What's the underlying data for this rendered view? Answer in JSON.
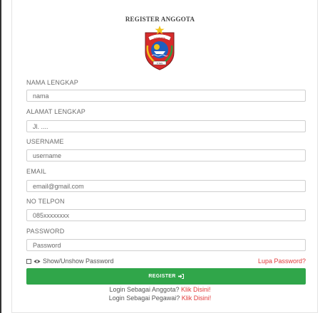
{
  "form": {
    "title": "REGISTER ANGGOTA",
    "logo_banner_text": "LEMBATA",
    "logo_scroll_text": "TITEN",
    "fields": {
      "nama": {
        "label": "NAMA LENGKAP",
        "placeholder": "nama"
      },
      "alamat": {
        "label": "ALAMAT LENGKAP",
        "placeholder": "Jl. ...."
      },
      "username": {
        "label": "USERNAME",
        "placeholder": "username"
      },
      "email": {
        "label": "EMAIL",
        "placeholder": "email@gmail.com"
      },
      "telpon": {
        "label": "NO TELPON",
        "placeholder": "085xxxxxxxx"
      },
      "password": {
        "label": "PASSWORD",
        "placeholder": "Password"
      }
    },
    "show_password_label": "Show/Unshow Password",
    "forgot_password": "Lupa Password?",
    "register_button": "REGISTER",
    "login_anggota_text": "Login Sebagai Anggota?",
    "login_pegawai_text": "Login Sebagai Pegawai?",
    "click_here": "Klik Disini!"
  },
  "colors": {
    "accent_green": "#30a64a",
    "link_red": "#e23b3b",
    "label_gray": "#6c6c6c"
  }
}
